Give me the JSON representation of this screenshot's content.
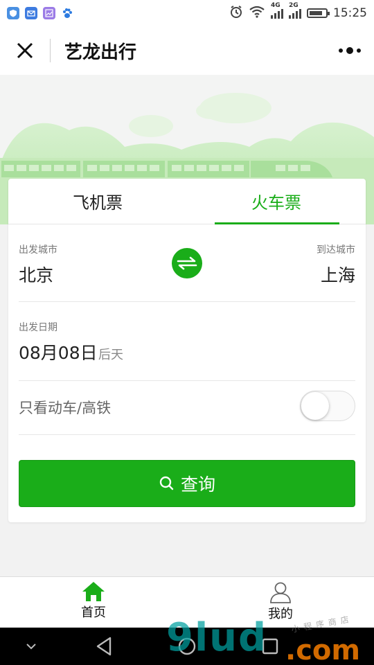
{
  "status_bar": {
    "time": "15:25",
    "net1": "4G",
    "net2": "2G",
    "battery_level": 0.8,
    "app_icons": [
      "shield-app-icon",
      "mail-app-icon",
      "gallery-app-icon",
      "baidu-app-icon"
    ],
    "app_colors": [
      "#4a90e2",
      "#3d7be0",
      "#9b7be6",
      "#2d7be0"
    ]
  },
  "titlebar": {
    "title": "艺龙出行"
  },
  "tabs": [
    {
      "label": "飞机票",
      "active": false
    },
    {
      "label": "火车票",
      "active": true
    }
  ],
  "form": {
    "from_label": "出发城市",
    "from_city": "北京",
    "to_label": "到达城市",
    "to_city": "上海",
    "date_label": "出发日期",
    "date_value": "08月08日",
    "date_hint": "后天",
    "toggle_label": "只看动车/高铁",
    "toggle_on": false,
    "search_label": "查询"
  },
  "bottom_tabs": [
    {
      "label": "首页",
      "icon": "home-icon",
      "active": true
    },
    {
      "label": "我的",
      "icon": "user-icon",
      "active": false
    }
  ],
  "watermark": {
    "main": "9lud",
    "suffix": ".com",
    "small": "小程序商店"
  },
  "colors": {
    "accent": "#1aad19",
    "banner_green": "#c9ecc0",
    "train_green": "#a9df9c"
  }
}
